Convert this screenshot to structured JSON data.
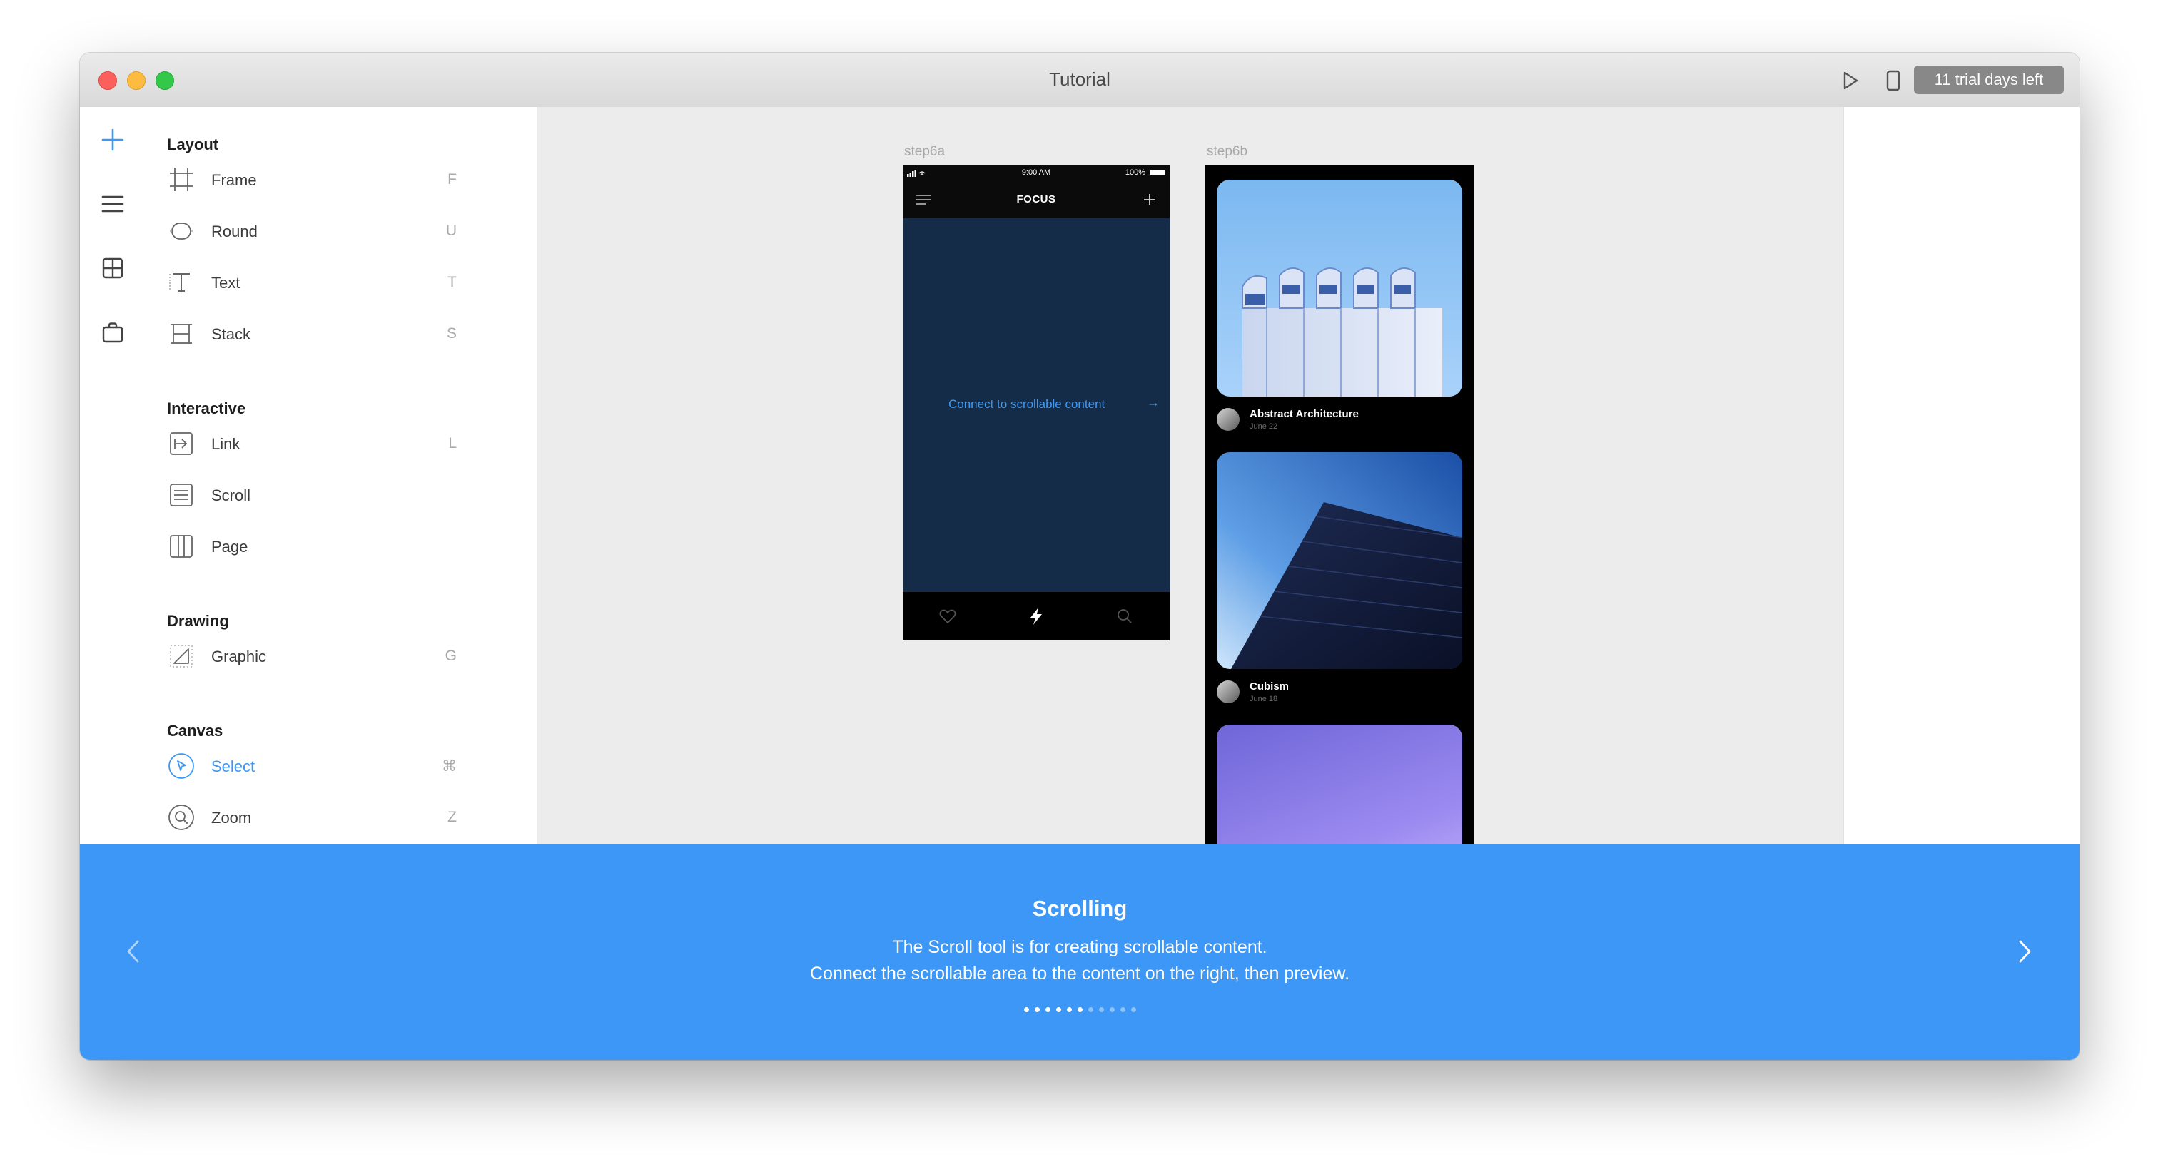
{
  "window": {
    "title": "Tutorial",
    "trial_badge": "11 trial days left",
    "toolbar_icons": [
      "play-icon",
      "device-icon",
      "comment-icon"
    ]
  },
  "rail_icons": [
    "plus-icon",
    "menu-lines-icon",
    "grid-icon",
    "bag-icon"
  ],
  "tools": {
    "layout": {
      "title": "Layout",
      "items": [
        {
          "label": "Frame",
          "key": "F",
          "icon": "frame-icon"
        },
        {
          "label": "Round",
          "key": "U",
          "icon": "round-icon"
        },
        {
          "label": "Text",
          "key": "T",
          "icon": "text-icon"
        },
        {
          "label": "Stack",
          "key": "S",
          "icon": "stack-icon"
        }
      ]
    },
    "interactive": {
      "title": "Interactive",
      "items": [
        {
          "label": "Link",
          "key": "L",
          "icon": "link-icon"
        },
        {
          "label": "Scroll",
          "key": "",
          "icon": "scroll-icon"
        },
        {
          "label": "Page",
          "key": "",
          "icon": "page-icon"
        }
      ]
    },
    "drawing": {
      "title": "Drawing",
      "items": [
        {
          "label": "Graphic",
          "key": "G",
          "icon": "graphic-icon"
        }
      ]
    },
    "canvas": {
      "title": "Canvas",
      "items": [
        {
          "label": "Select",
          "key": "⌘",
          "icon": "select-icon",
          "active": true
        },
        {
          "label": "Zoom",
          "key": "Z",
          "icon": "zoom-icon"
        }
      ]
    }
  },
  "frames": {
    "step6a": {
      "label": "step6a",
      "time": "9:00 AM",
      "battery": "100%",
      "nav_title": "FOCUS",
      "connect_text": "Connect to scrollable content",
      "connect_arrow": "→",
      "tab_icons": [
        "heart-icon",
        "bolt-icon",
        "search-icon"
      ]
    },
    "step6b": {
      "label": "step6b",
      "posts": [
        {
          "title": "Abstract Architecture",
          "date": "June 22"
        },
        {
          "title": "Cubism",
          "date": "June 18"
        }
      ]
    }
  },
  "tutorial": {
    "title": "Scrolling",
    "line1": "The Scroll tool is for creating scrollable content.",
    "line2": "Connect the scrollable area to the content on the right, then preview.",
    "total_steps": 11,
    "current_step": 6
  },
  "colors": {
    "accent": "#3d97f6",
    "link_blue": "#3f9af4",
    "phone_content_bg": "#152c48",
    "trial_badge_bg": "#888888"
  }
}
